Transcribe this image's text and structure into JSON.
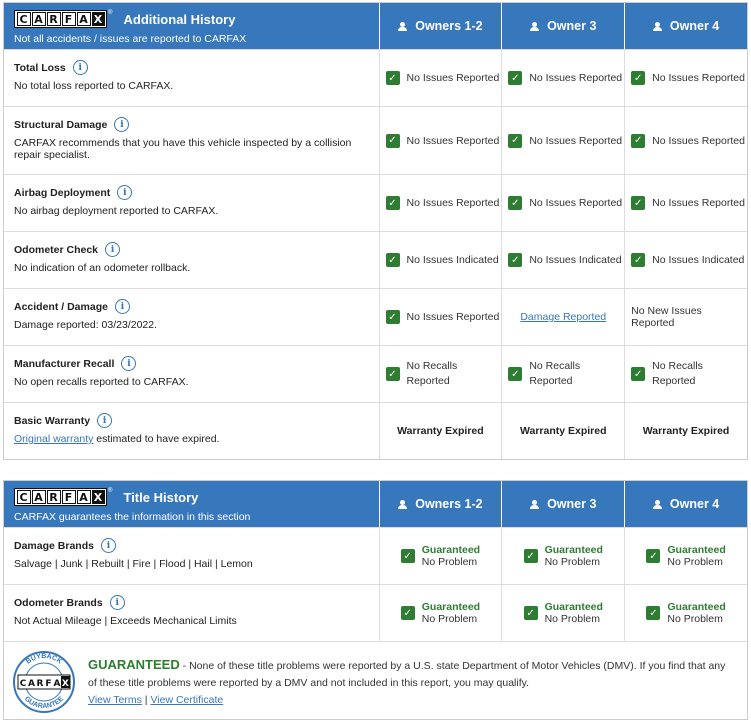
{
  "brand": {
    "logo_letters": [
      "C",
      "A",
      "R",
      "F",
      "A",
      "X"
    ],
    "registered": "®"
  },
  "colors": {
    "header_blue": "#3777bc",
    "check_green": "#2e7d32",
    "link_blue": "#3777bc"
  },
  "additional": {
    "title": "Additional History",
    "subtitle": "Not all accidents / issues are reported to CARFAX",
    "owners": [
      "Owners 1-2",
      "Owner 3",
      "Owner 4"
    ],
    "rows": [
      {
        "title": "Total Loss",
        "desc": "No total loss reported to CARFAX.",
        "cells": [
          {
            "text": "No Issues Reported",
            "check": true
          },
          {
            "text": "No Issues Reported",
            "check": true
          },
          {
            "text": "No Issues Reported",
            "check": true
          }
        ]
      },
      {
        "title": "Structural Damage",
        "desc": "CARFAX recommends that you have this vehicle inspected by a collision repair specialist.",
        "cells": [
          {
            "text": "No Issues Reported",
            "check": true
          },
          {
            "text": "No Issues Reported",
            "check": true
          },
          {
            "text": "No Issues Reported",
            "check": true
          }
        ]
      },
      {
        "title": "Airbag Deployment",
        "desc": "No airbag deployment reported to CARFAX.",
        "cells": [
          {
            "text": "No Issues Reported",
            "check": true
          },
          {
            "text": "No Issues Reported",
            "check": true
          },
          {
            "text": "No Issues Reported",
            "check": true
          }
        ]
      },
      {
        "title": "Odometer Check",
        "desc": "No indication of an odometer rollback.",
        "cells": [
          {
            "text": "No Issues Indicated",
            "check": true
          },
          {
            "text": "No Issues Indicated",
            "check": true
          },
          {
            "text": "No Issues Indicated",
            "check": true
          }
        ]
      },
      {
        "title": "Accident / Damage",
        "desc": "Damage reported: 03/23/2022.",
        "cells": [
          {
            "text": "No Issues Reported",
            "check": true
          },
          {
            "text": "Damage Reported",
            "link": true
          },
          {
            "text": "No New Issues Reported"
          }
        ]
      },
      {
        "title": "Manufacturer Recall",
        "desc": "No open recalls reported to CARFAX.",
        "cells": [
          {
            "text": "No Recalls Reported",
            "check": true
          },
          {
            "text": "No Recalls Reported",
            "check": true
          },
          {
            "text": "No Recalls Reported",
            "check": true
          }
        ]
      },
      {
        "title": "Basic Warranty",
        "desc_link": "Original warranty",
        "desc_rest": " estimated to have expired.",
        "cells": [
          {
            "text": "Warranty Expired",
            "bold": true
          },
          {
            "text": "Warranty Expired",
            "bold": true
          },
          {
            "text": "Warranty Expired",
            "bold": true
          }
        ]
      }
    ]
  },
  "title_history": {
    "title": "Title History",
    "subtitle": "CARFAX guarantees the information in this section",
    "owners": [
      "Owners 1-2",
      "Owner 3",
      "Owner 4"
    ],
    "rows": [
      {
        "title": "Damage Brands",
        "desc": "Salvage | Junk | Rebuilt | Fire | Flood | Hail | Lemon",
        "cells": [
          {
            "g": "Guaranteed",
            "p": "No Problem"
          },
          {
            "g": "Guaranteed",
            "p": "No Problem"
          },
          {
            "g": "Guaranteed",
            "p": "No Problem"
          }
        ]
      },
      {
        "title": "Odometer Brands",
        "desc": "Not Actual Mileage | Exceeds Mechanical Limits",
        "cells": [
          {
            "g": "Guaranteed",
            "p": "No Problem"
          },
          {
            "g": "Guaranteed",
            "p": "No Problem"
          },
          {
            "g": "Guaranteed",
            "p": "No Problem"
          }
        ]
      }
    ]
  },
  "guarantee": {
    "badge_top": "BUYBACK",
    "badge_bottom": "GUARANTEE",
    "heading": "GUARANTEED",
    "text": " - None of these title problems were reported by a U.S. state Department of Motor Vehicles (DMV). If you find that any of these title problems were reported by a DMV and not included in this report, you may qualify.",
    "link_terms": "View Terms",
    "separator": " | ",
    "link_certificate": "View Certificate"
  }
}
